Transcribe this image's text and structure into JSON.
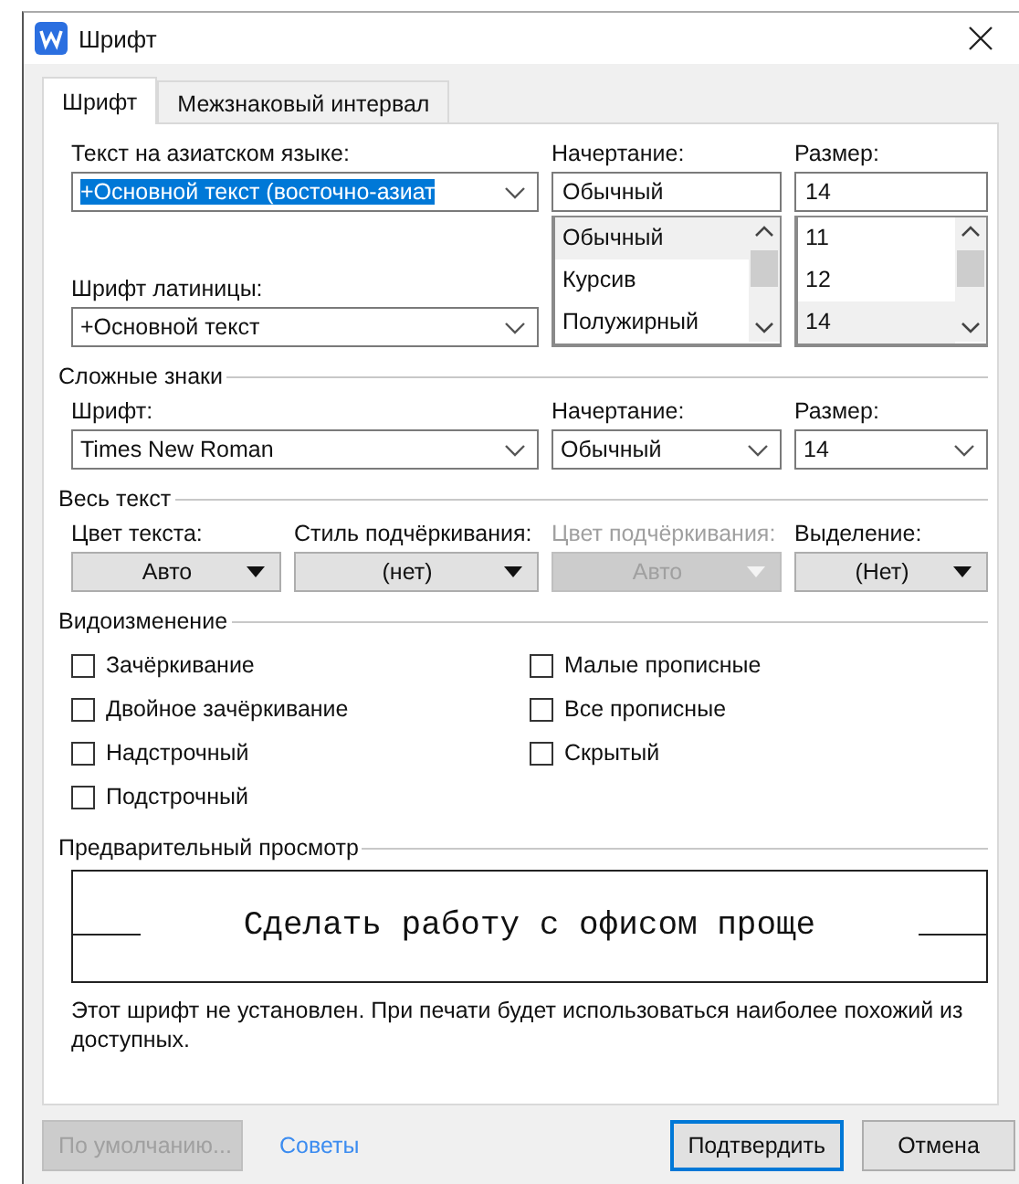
{
  "window": {
    "title": "Шрифт"
  },
  "tabs": [
    {
      "label": "Шрифт",
      "selected": true
    },
    {
      "label": "Межзнаковый интервал",
      "selected": false
    }
  ],
  "asian_font": {
    "label": "Текст на азиатском языке:",
    "value": "+Основной текст (восточно-азиат",
    "text_selected": true
  },
  "latin_font": {
    "label": "Шрифт латиницы:",
    "value": "+Основной текст"
  },
  "style": {
    "label": "Начертание:",
    "value": "Обычный",
    "options": [
      {
        "label": "Обычный",
        "selected": true
      },
      {
        "label": "Курсив",
        "selected": false
      },
      {
        "label": "Полужирный",
        "selected": false
      }
    ]
  },
  "size": {
    "label": "Размер:",
    "value": "14",
    "options": [
      {
        "label": "11",
        "selected": false
      },
      {
        "label": "12",
        "selected": false
      },
      {
        "label": "14",
        "selected": true
      }
    ]
  },
  "complex_script": {
    "title": "Сложные знаки",
    "fields": [
      {
        "label": "Шрифт:",
        "value": "Times New Roman"
      },
      {
        "label": "Начертание:",
        "value": "Обычный"
      },
      {
        "label": "Размер:",
        "value": "14"
      }
    ]
  },
  "all_text": {
    "title": "Весь текст",
    "fields": [
      {
        "label": "Цвет текста:",
        "value": "Авто",
        "disabled": false
      },
      {
        "label": "Стиль подчёркивания:",
        "value": "(нет)",
        "disabled": false
      },
      {
        "label": "Цвет подчёркивания:",
        "value": "Авто",
        "disabled": true
      },
      {
        "label": "Выделение:",
        "value": "(Нет)",
        "disabled": false
      }
    ]
  },
  "effects": {
    "title": "Видоизменение",
    "options": [
      {
        "label": "Зачёркивание",
        "checked": false
      },
      {
        "label": "Двойное зачёркивание",
        "checked": false
      },
      {
        "label": "Надстрочный",
        "checked": false
      },
      {
        "label": "Подстрочный",
        "checked": false
      },
      {
        "label": "Малые прописные",
        "checked": false
      },
      {
        "label": "Все прописные",
        "checked": false
      },
      {
        "label": "Скрытый",
        "checked": false
      }
    ]
  },
  "preview": {
    "title": "Предварительный просмотр",
    "sample": "Сделать работу с офисом проще",
    "note": "Этот шрифт не установлен. При печати будет использоваться наиболее похожий из доступных."
  },
  "buttons": [
    {
      "label": "По умолчанию...",
      "kind": "button",
      "disabled": true,
      "default": false
    },
    {
      "label": "Советы",
      "kind": "link",
      "disabled": false,
      "default": false
    },
    {
      "label": "Подтвердить",
      "kind": "button",
      "disabled": false,
      "default": true
    },
    {
      "label": "Отмена",
      "kind": "button",
      "disabled": false,
      "default": false
    }
  ]
}
